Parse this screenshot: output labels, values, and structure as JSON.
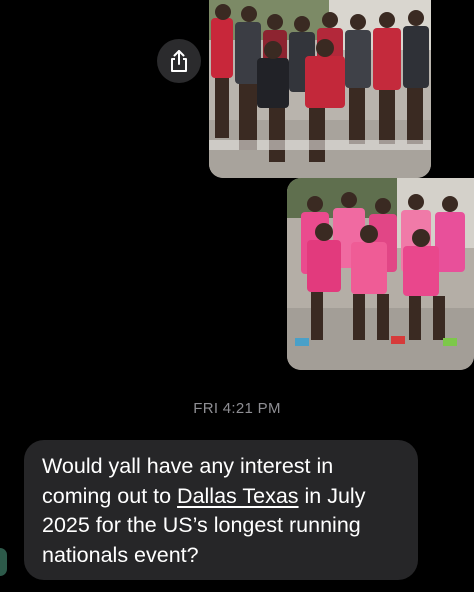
{
  "message_thread": {
    "share_button": {
      "icon": "share-icon"
    },
    "photos": [
      {
        "id": "team-photo-boys",
        "description_icon": "photo-image"
      },
      {
        "id": "team-photo-girls",
        "description_icon": "photo-image"
      }
    ],
    "timestamp": "FRI 4:21 PM",
    "message": {
      "part1": "Would yall have any interest in coming out to ",
      "link": "Dallas Texas",
      "part2": " in July 2025 for the US’s longest running nationals event?"
    }
  },
  "colors": {
    "background": "#000000",
    "bubble": "#262628",
    "timestamp": "#8e8e93",
    "share_button": "#2b2b2d"
  }
}
